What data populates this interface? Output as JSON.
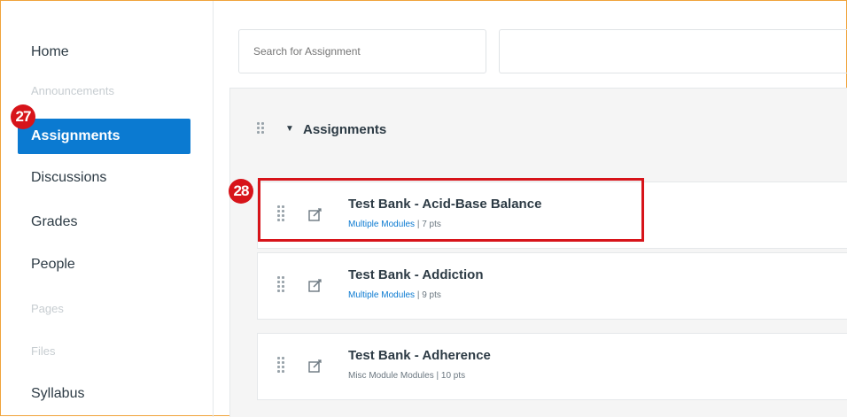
{
  "sidebar": {
    "items": [
      {
        "label": "Home",
        "state": "normal"
      },
      {
        "label": "Announcements",
        "state": "disabled"
      },
      {
        "label": "Assignments",
        "state": "active"
      },
      {
        "label": "Discussions",
        "state": "normal"
      },
      {
        "label": "Grades",
        "state": "normal"
      },
      {
        "label": "People",
        "state": "normal"
      },
      {
        "label": "Pages",
        "state": "disabled"
      },
      {
        "label": "Files",
        "state": "disabled"
      },
      {
        "label": "Syllabus",
        "state": "normal"
      }
    ]
  },
  "badges": {
    "step_27": "27",
    "step_28": "28"
  },
  "search": {
    "placeholder": "Search for Assignment"
  },
  "group": {
    "title": "Assignments",
    "caret_icon": "caret-down-icon",
    "rows": [
      {
        "title": "Test Bank - Acid-Base Balance",
        "modules": "Multiple Modules",
        "separator": "|",
        "points": "7 pts",
        "icon": "assignment-icon"
      },
      {
        "title": "Test Bank - Addiction",
        "modules": "Multiple Modules",
        "separator": "|",
        "points": "9 pts",
        "icon": "assignment-icon"
      },
      {
        "title": "Test Bank - Adherence",
        "modules": "Misc Module Modules",
        "separator": "|",
        "points": "10 pts",
        "icon": "assignment-icon"
      }
    ]
  },
  "colors": {
    "active_nav": "#0b7ad1",
    "badge": "#d7141a",
    "highlight_border": "#d7141a",
    "frame_border": "#f0a33a",
    "module_link": "#0b7ad1"
  }
}
